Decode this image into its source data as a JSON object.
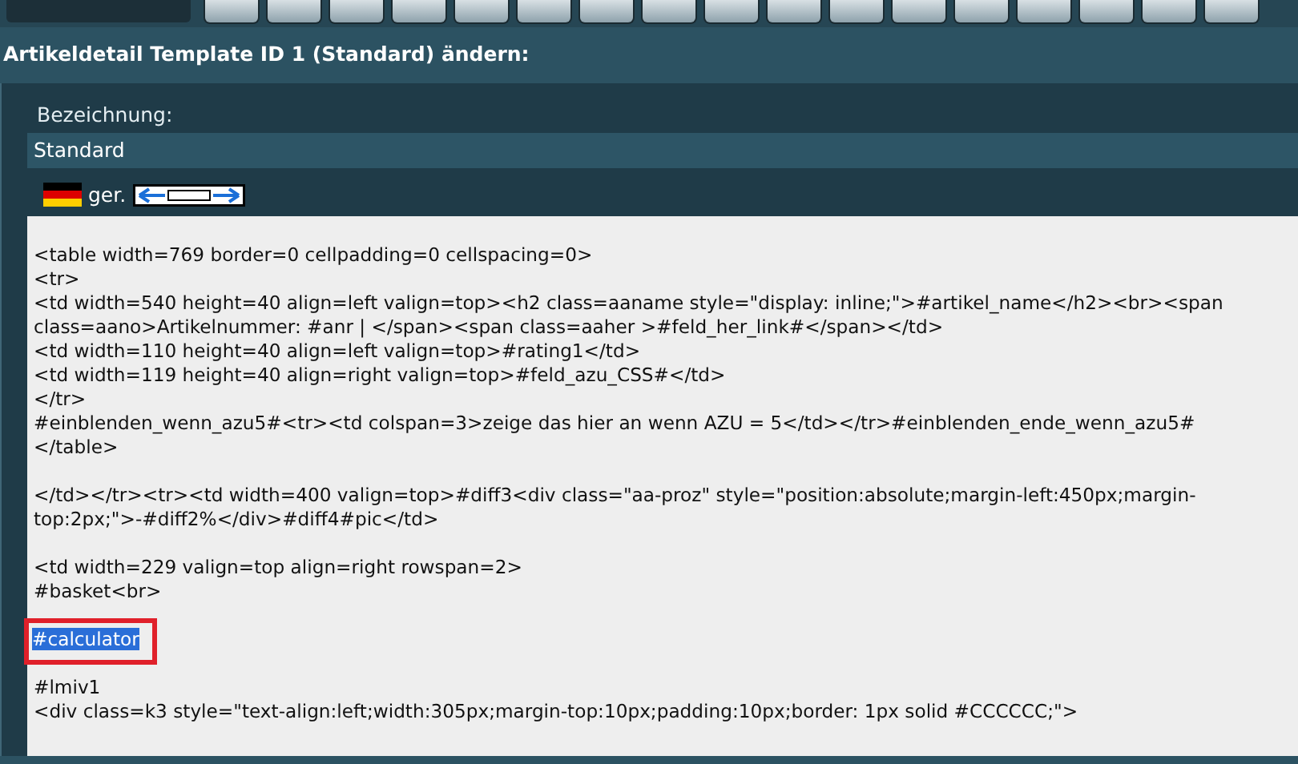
{
  "page_title": "Artikeldetail Template ID 1 (Standard) ändern:",
  "name_field": {
    "label": "Bezeichnung:",
    "value": "Standard"
  },
  "language": {
    "label": "ger."
  },
  "code": {
    "blocks": [
      {
        "lines": [
          {
            "text": "<table width=769 border=0 cellpadding=0 cellspacing=0>",
            "selected": false,
            "annotated": false
          },
          {
            "text": "<tr>",
            "selected": false,
            "annotated": false
          },
          {
            "text": "<td width=540 height=40 align=left valign=top><h2 class=aaname  style=\"display: inline;\">#artikel_name</h2><br><span",
            "selected": false,
            "annotated": false
          },
          {
            "text": "class=aano>Artikelnummer: #anr  |  </span><span class=aaher >#feld_her_link#</span></td>",
            "selected": false,
            "annotated": false
          },
          {
            "text": "<td width=110 height=40 align=left valign=top>#rating1</td>",
            "selected": false,
            "annotated": false
          },
          {
            "text": "<td width=119 height=40 align=right valign=top>#feld_azu_CSS#</td>",
            "selected": false,
            "annotated": false
          },
          {
            "text": "</tr>",
            "selected": false,
            "annotated": false
          },
          {
            "text": "#einblenden_wenn_azu5#<tr><td colspan=3>zeige das hier an wenn AZU = 5</td></tr>#einblenden_ende_wenn_azu5#",
            "selected": false,
            "annotated": false
          },
          {
            "text": "</table>",
            "selected": false,
            "annotated": false
          }
        ]
      },
      {
        "lines": [
          {
            "text": "</td></tr><tr><td width=400 valign=top>#diff3<div class=\"aa-proz\" style=\"position:absolute;margin-left:450px;margin-",
            "selected": false,
            "annotated": false
          },
          {
            "text": "top:2px;\">-#diff2%</div>#diff4#pic</td>",
            "selected": false,
            "annotated": false
          }
        ]
      },
      {
        "lines": [
          {
            "text": "<td width=229 valign=top align=right rowspan=2>",
            "selected": false,
            "annotated": false
          },
          {
            "text": "#basket<br>",
            "selected": false,
            "annotated": false
          }
        ]
      },
      {
        "lines": [
          {
            "text": "#calculator",
            "selected": true,
            "annotated": true
          }
        ]
      },
      {
        "lines": [
          {
            "text": "#lmiv1",
            "selected": false,
            "annotated": false
          },
          {
            "text": "<div class=k3 style=\"text-align:left;width:305px;margin-top:10px;padding:10px;border: 1px solid #CCCCCC;\">",
            "selected": false,
            "annotated": false
          }
        ]
      }
    ]
  }
}
